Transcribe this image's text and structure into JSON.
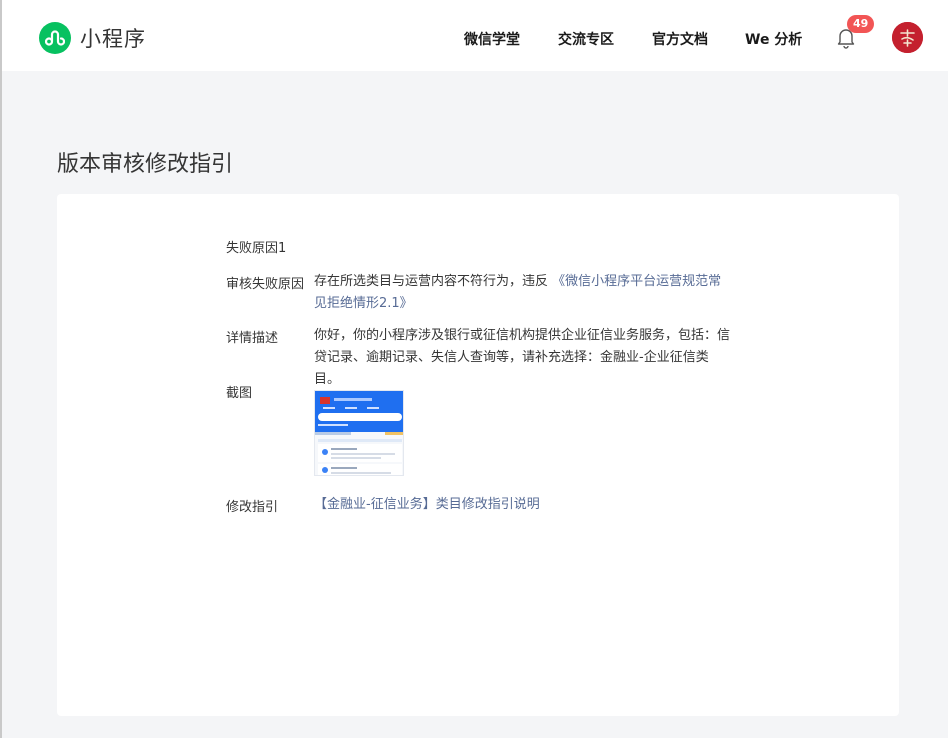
{
  "header": {
    "logo_text": "小程序",
    "nav": [
      {
        "label": "微信学堂"
      },
      {
        "label": "交流专区"
      },
      {
        "label": "官方文档"
      },
      {
        "label": "We 分析"
      }
    ],
    "notifications": {
      "count": "49",
      "icon": "bell-icon"
    },
    "avatar_icon": "user-avatar"
  },
  "page": {
    "title": "版本审核修改指引"
  },
  "reason": {
    "section_title": "失败原因1",
    "rows": {
      "failure_reason": {
        "label": "审核失败原因",
        "text": "存在所选类目与运营内容不符行为，违反",
        "link": "《微信小程序平台运营规范常见拒绝情形2.1》"
      },
      "details": {
        "label": "详情描述",
        "text": "你好，你的小程序涉及银行或征信机构提供企业征信业务服务，包括：信贷记录、逾期记录、失信人查询等，请补充选择：金融业-企业征信类目。"
      },
      "screenshot": {
        "label": "截图"
      },
      "guide": {
        "label": "修改指引",
        "link": "【金融业-征信业务】类目修改指引说明"
      }
    }
  },
  "colors": {
    "brand_green": "#07c160",
    "link": "#576b95",
    "badge": "#f25555",
    "avatar": "#c4202e"
  }
}
